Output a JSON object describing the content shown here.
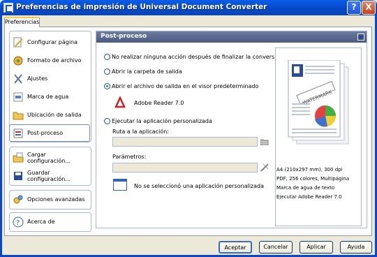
{
  "window": {
    "title": "Preferencias de impresión de Universal Document Converter",
    "help": "?",
    "close": "X"
  },
  "tab": "Preferencias",
  "nav": {
    "group1": [
      "Configurar página",
      "Formato de archivo",
      "Ajustes",
      "Marca de agua",
      "Ubicación de salida",
      "Post-proceso"
    ],
    "group2": [
      "Cargar configuración...",
      "Guardar configuración..."
    ],
    "advanced": "Opciones avanzadas",
    "about": "Acerca de",
    "selected": "Post-proceso"
  },
  "panel": {
    "title": "Post-proceso",
    "options": [
      "No realizar ninguna acción después de finalizar la conversión",
      "Abrir la carpeta de salida",
      "Abrir el archivo de salida en el visor predeterminado",
      "Ejecutar la aplicación personalizada"
    ],
    "selected_option": 2,
    "viewer": "Adobe Reader 7.0",
    "app_path_label": "Ruta a la aplicación:",
    "app_path_value": "",
    "params_label": "Parámetros:",
    "params_value": "",
    "no_app": "No se seleccionó una aplicación personalizada"
  },
  "preview": {
    "watermark": "WATERMARK",
    "info": [
      "A4 (210x297 mm), 300 dpi",
      "PDF, 256 colores, Multipágina",
      "Marca de agua de texto",
      "Ejecutar Adobe Reader 7.0"
    ]
  },
  "buttons": {
    "ok": "Aceptar",
    "cancel": "Cancelar",
    "apply": "Aplicar",
    "help": "Ayuda"
  }
}
